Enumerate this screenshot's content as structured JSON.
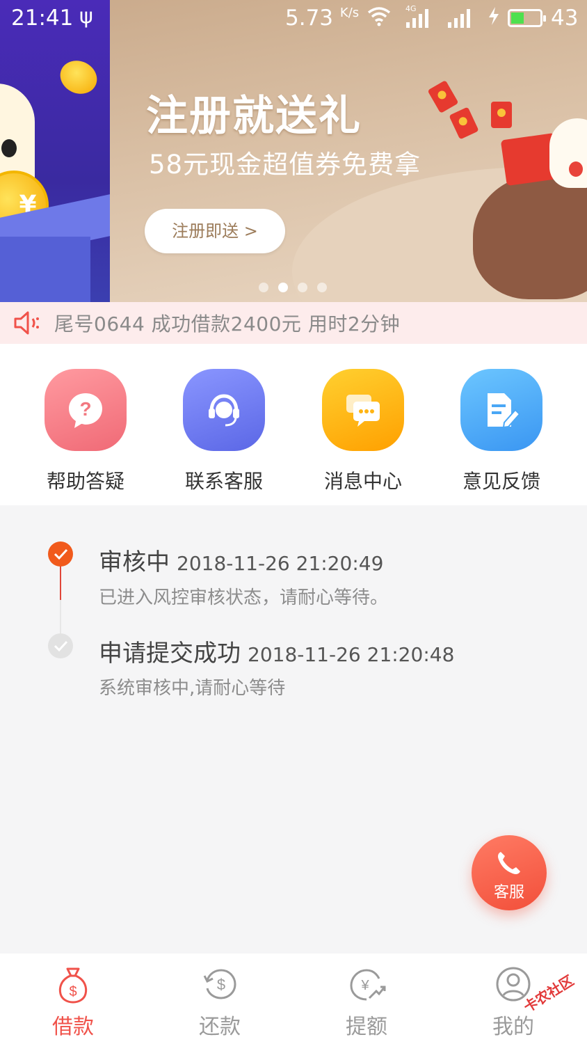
{
  "status_bar": {
    "time": "21:41",
    "usb": "ψ",
    "speed": "5.73",
    "speed_unit": "K/s",
    "network": "4G",
    "battery": "43"
  },
  "banner": {
    "title": "注册就送礼",
    "subtitle": "58元现金超值券免费拿",
    "button": "注册即送 >",
    "coin_symbol": "¥",
    "page_count": 4,
    "active_page": 2
  },
  "notice": {
    "text": "尾号0644 成功借款2400元 用时2分钟"
  },
  "menu": {
    "items": [
      {
        "label": "帮助答疑",
        "icon": "help-question-icon",
        "color": "#f47a82"
      },
      {
        "label": "联系客服",
        "icon": "customer-service-headset-icon",
        "color": "#6f7df0"
      },
      {
        "label": "消息中心",
        "icon": "message-bubble-icon",
        "color": "#ffb414"
      },
      {
        "label": "意见反馈",
        "icon": "feedback-edit-icon",
        "color": "#4aa7f5"
      }
    ]
  },
  "timeline": {
    "steps": [
      {
        "title": "审核中",
        "time": "2018-11-26 21:20:49",
        "desc": "已进入风控审核状态，请耐心等待。",
        "state": "active"
      },
      {
        "title": "申请提交成功",
        "time": "2018-11-26 21:20:48",
        "desc": "系统审核中,请耐心等待",
        "state": "done"
      }
    ]
  },
  "fab": {
    "label": "客服"
  },
  "tabbar": {
    "tabs": [
      {
        "label": "借款",
        "icon": "money-bag-icon",
        "active": true
      },
      {
        "label": "还款",
        "icon": "repay-cycle-icon",
        "active": false
      },
      {
        "label": "提额",
        "icon": "raise-limit-icon",
        "active": false
      },
      {
        "label": "我的",
        "icon": "user-profile-icon",
        "active": false
      }
    ]
  },
  "watermark": "卡农社区",
  "colors": {
    "accent": "#f0524a",
    "timeline_active": "#f15a1c",
    "notice_bg": "#fdecec"
  }
}
